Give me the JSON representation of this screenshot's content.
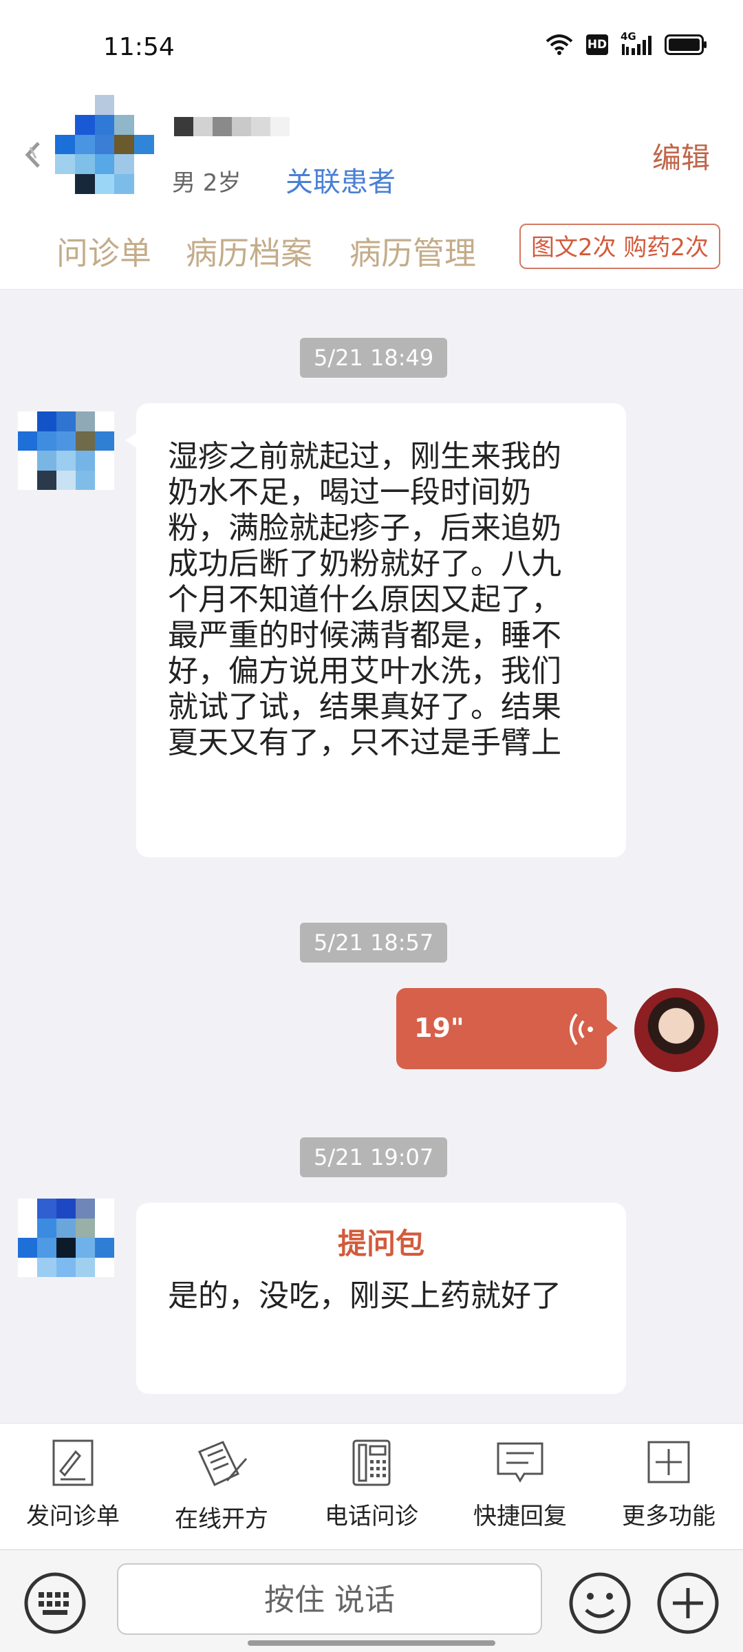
{
  "status_bar": {
    "time": "11:54",
    "network": "4G"
  },
  "header": {
    "patient_gender_age": "男 2岁",
    "link_patient_label": "关联患者",
    "edit_label": "编辑",
    "tabs": [
      "问诊单",
      "病历档案",
      "病历管理"
    ],
    "quota_badge": "图文2次 购药2次"
  },
  "chat": {
    "messages": [
      {
        "timestamp": "5/21 18:49",
        "sender": "patient",
        "text": "湿疹之前就起过，刚生来我的\n奶水不足，喝过一段时间奶\n粉，满脸就起疹子，后来追奶\n成功后断了奶粉就好了。八九\n个月不知道什么原因又起了，\n最严重的时候满背都是，睡不\n好，偏方说用艾叶水洗，我们\n就试了试，结果真好了。结果\n夏天又有了，只不过是手臂上"
      },
      {
        "timestamp": "5/21 18:57",
        "sender": "doctor",
        "voice_duration": "19\""
      },
      {
        "timestamp": "5/21 19:07",
        "sender": "patient",
        "card_title": "提问包",
        "text": "是的，没吃，刚买上药就好了"
      }
    ]
  },
  "toolbar": {
    "items": [
      {
        "label": "发问诊单",
        "icon": "form-icon"
      },
      {
        "label": "在线开方",
        "icon": "prescription-icon"
      },
      {
        "label": "电话问诊",
        "icon": "phone-icon"
      },
      {
        "label": "快捷回复",
        "icon": "quick-reply-icon"
      },
      {
        "label": "更多功能",
        "icon": "plus-square-icon"
      }
    ]
  },
  "input_bar": {
    "hold_to_talk_label": "按住 说话"
  },
  "colors": {
    "accent": "#d6604a",
    "tab_text": "#c4ac8a",
    "link": "#4a7fd4"
  }
}
